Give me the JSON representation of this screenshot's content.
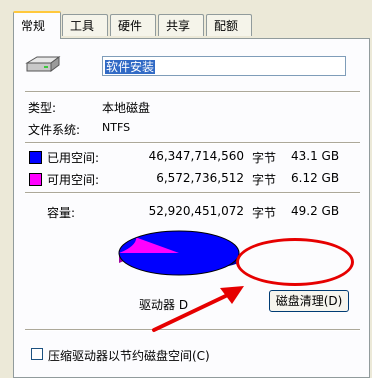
{
  "tabs": [
    {
      "label": "常规"
    },
    {
      "label": "工具"
    },
    {
      "label": "硬件"
    },
    {
      "label": "共享"
    },
    {
      "label": "配额"
    }
  ],
  "general": {
    "drive_name": "软件安装",
    "type_label": "类型:",
    "type_value": "本地磁盘",
    "fs_label": "文件系统:",
    "fs_value": "NTFS",
    "used_label": "已用空间:",
    "used_bytes": "46,347,714,560",
    "used_unit": "字节",
    "used_size": "43.1 GB",
    "free_label": "可用空间:",
    "free_bytes": "6,572,736,512",
    "free_unit": "字节",
    "free_size": "6.12 GB",
    "capacity_label": "容量:",
    "capacity_bytes": "52,920,451,072",
    "capacity_unit": "字节",
    "capacity_size": "49.2 GB",
    "drive_label": "驱动器 D",
    "cleanup_button": "磁盘清理(D)",
    "compress_label": "压缩驱动器以节约磁盘空间(C)",
    "used_fraction": 0.876,
    "colors": {
      "used": "#0000ff",
      "free": "#ff00ff",
      "used_dark": "#0000a0",
      "free_dark": "#a000a0",
      "annotation": "#e60000"
    }
  }
}
